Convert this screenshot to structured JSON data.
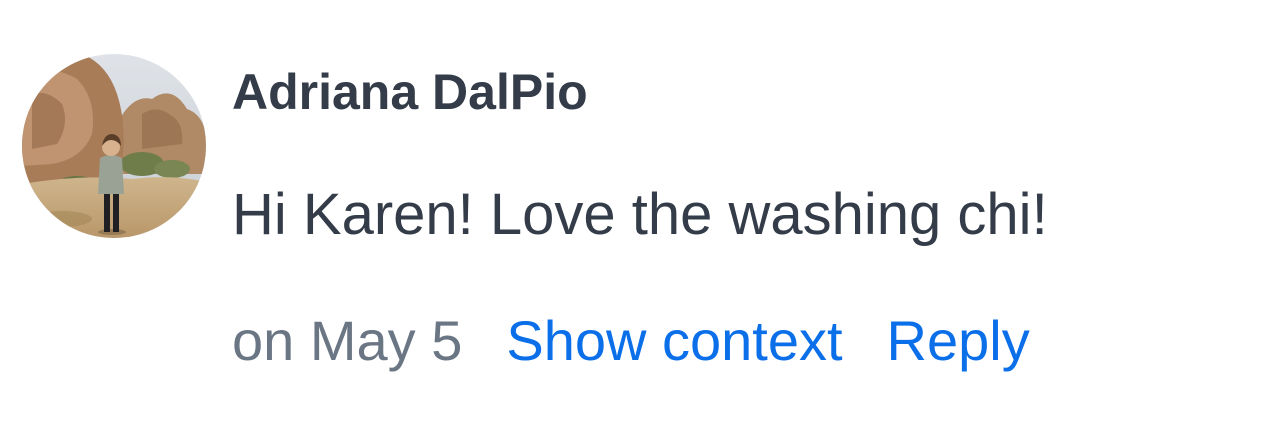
{
  "comment": {
    "author": "Adriana DalPio",
    "message": "Hi Karen! Love the washing chi!",
    "timestamp": "on May 5",
    "show_context_label": "Show context",
    "reply_label": "Reply",
    "avatar_icon": "user-avatar-photo"
  },
  "colors": {
    "text_primary": "#333c48",
    "text_secondary": "#6b7685",
    "link": "#0a6fe8",
    "background": "#ffffff"
  }
}
